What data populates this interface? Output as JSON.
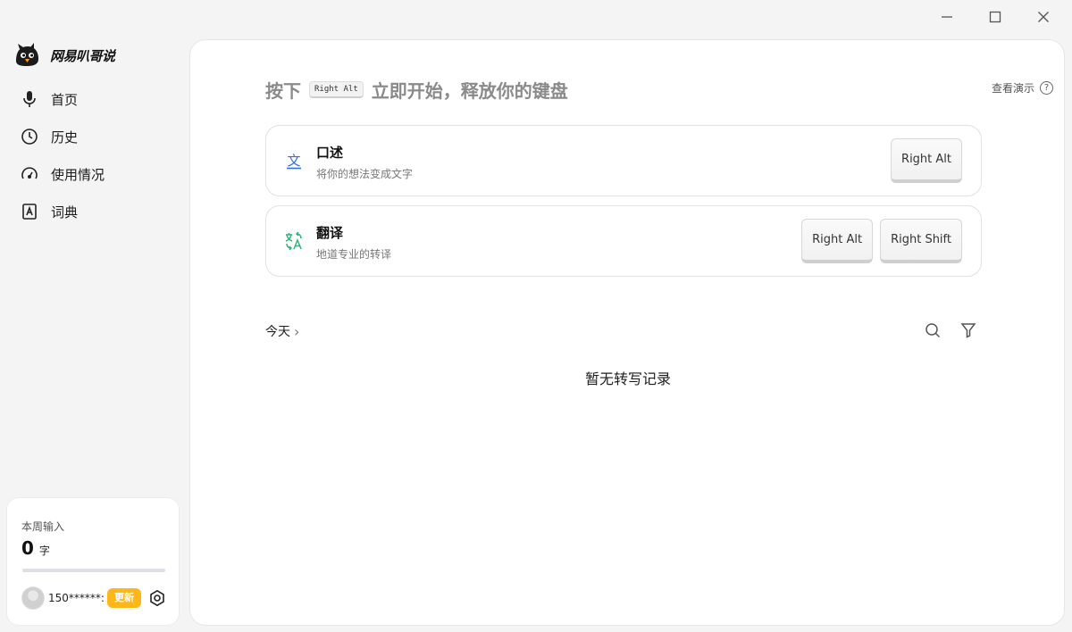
{
  "app": {
    "name": "网易叭哥说"
  },
  "sidebar": {
    "items": [
      {
        "label": "首页",
        "icon": "microphone-icon"
      },
      {
        "label": "历史",
        "icon": "clock-icon"
      },
      {
        "label": "使用情况",
        "icon": "gauge-icon"
      },
      {
        "label": "词典",
        "icon": "dictionary-icon"
      }
    ]
  },
  "weekly": {
    "label": "本周输入",
    "count": "0",
    "unit": "字",
    "progress": 0
  },
  "user": {
    "phone": "150******:",
    "update_label": "更新"
  },
  "main": {
    "headline_prefix": "按下",
    "headline_key": "Right Alt",
    "headline_suffix": "立即开始，释放你的键盘",
    "demo_link": "查看演示",
    "help_glyph": "?",
    "features": [
      {
        "title": "口述",
        "subtitle": "将你的想法变成文字",
        "icon": "text-wen-icon",
        "keys": [
          "Right Alt"
        ]
      },
      {
        "title": "翻译",
        "subtitle": "地道专业的转译",
        "icon": "translate-icon",
        "keys": [
          "Right Alt",
          "Right Shift"
        ]
      }
    ],
    "today_label": "今天",
    "today_chevron": "›",
    "empty_message": "暂无转写记录"
  },
  "colors": {
    "accent_blue": "#2f6fe0",
    "accent_green": "#2fb37a",
    "update_yellow": "#ffb619"
  }
}
